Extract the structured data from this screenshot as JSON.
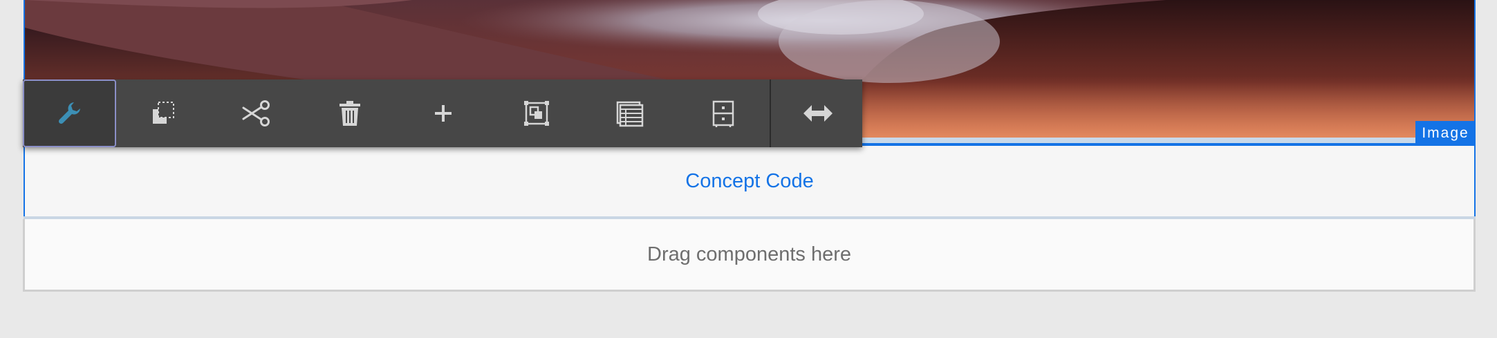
{
  "editor": {
    "component_badge": "Image",
    "concept_text": "Concept Code",
    "drop_zone_text": "Drag components here"
  },
  "toolbar": {
    "buttons": [
      {
        "icon": "wrench-icon",
        "action": "configure",
        "active": true
      },
      {
        "icon": "copy-icon",
        "action": "copy"
      },
      {
        "icon": "scissors-icon",
        "action": "cut"
      },
      {
        "icon": "trash-icon",
        "action": "delete"
      },
      {
        "icon": "plus-icon",
        "action": "insert"
      },
      {
        "icon": "group-icon",
        "action": "group"
      },
      {
        "icon": "layout-icon",
        "action": "layout"
      },
      {
        "icon": "cabinet-icon",
        "action": "parent"
      },
      {
        "icon": "resize-horizontal-icon",
        "action": "resize"
      }
    ]
  },
  "colors": {
    "accent": "#1473e6",
    "toolbar_bg": "#474747",
    "active_icon": "#3c8fb5",
    "icon": "#d6d6d6"
  }
}
